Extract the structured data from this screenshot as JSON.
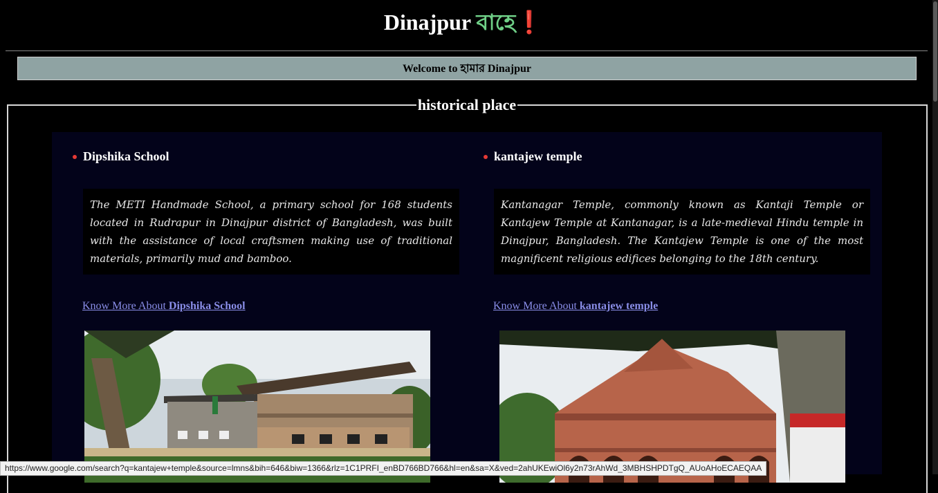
{
  "header": {
    "title_main": "Dinajpur ",
    "title_accent": "বাহে",
    "title_bang": "❗"
  },
  "welcome": {
    "prefix": "Welcome to ",
    "bengali": "হামার",
    "suffix": " Dinajpur"
  },
  "section": {
    "legend": "historical place"
  },
  "places": [
    {
      "name": "Dipshika School",
      "description": "The METI Handmade School, a primary school for 168 students located in Rudrapur in Dinajpur district of Bangladesh, was built with the assistance of local craftsmen making use of traditional materials, primarily mud and bamboo.",
      "link_prefix": "Know More About ",
      "link_name": "Dipshika School",
      "image_alt": "school-building-photo"
    },
    {
      "name": "kantajew temple",
      "description": "Kantanagar Temple, commonly known as Kantaji Temple or Kantajew Temple at Kantanagar, is a late-medieval Hindu temple in Dinajpur, Bangladesh. The Kantajew Temple is one of the most magnificent religious edifices belonging to the 18th century.",
      "link_prefix": "Know More About ",
      "link_name": "kantajew temple",
      "image_alt": "terracotta-temple-photo"
    }
  ],
  "status_bar": {
    "url": "https://www.google.com/search?q=kantajew+temple&source=lmns&bih=646&biw=1366&rlz=1C1PRFI_enBD766BD766&hl=en&sa=X&ved=2ahUKEwiOl6y2n73rAhWd_3MBHSHPDTgQ_AUoAHoECAEQAA"
  },
  "colors": {
    "accent_green": "#6fcf87",
    "bullet_red": "#e53935",
    "link_blue": "#8a8ee8",
    "welcome_bg": "#8fa3a3",
    "panel_bg": "#03031a"
  }
}
